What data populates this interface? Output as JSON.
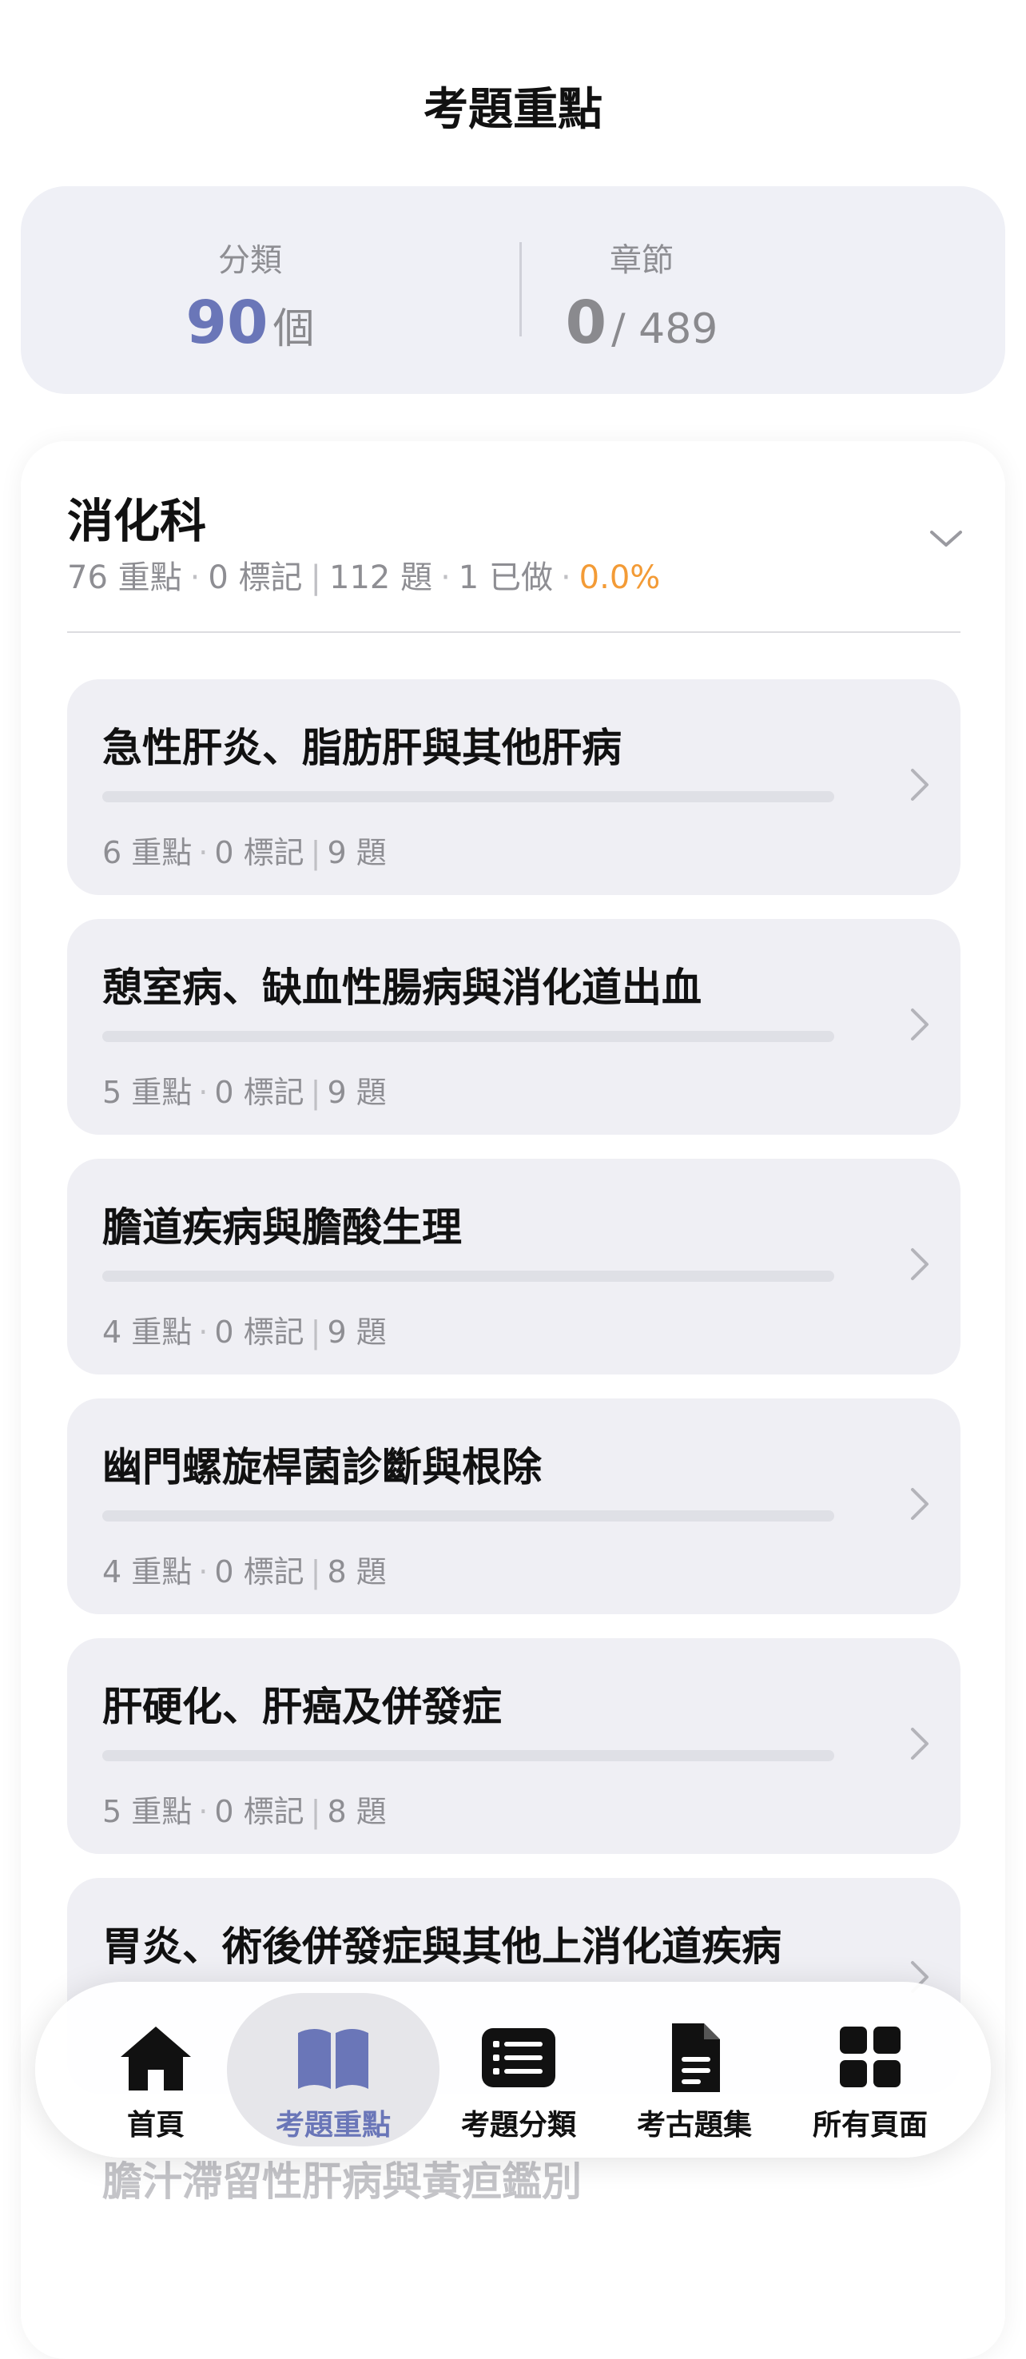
{
  "header": {
    "title": "考題重點"
  },
  "stats": {
    "category_label": "分類",
    "category_value": "90",
    "category_unit": "個",
    "chapter_label": "章節",
    "chapter_done": "0",
    "chapter_total": "/ 489"
  },
  "section": {
    "title": "消化科",
    "points": "76 重點",
    "marks": "0 標記",
    "questions": "112 題",
    "done": "1 已做",
    "percent": "0.0%"
  },
  "chapters": [
    {
      "title": "急性肝炎、脂肪肝與其他肝病",
      "points": "6 重點",
      "marks": "0 標記",
      "questions": "9 題",
      "progress": 0
    },
    {
      "title": "憩室病、缺血性腸病與消化道出血",
      "points": "5 重點",
      "marks": "0 標記",
      "questions": "9 題",
      "progress": 0
    },
    {
      "title": "膽道疾病與膽酸生理",
      "points": "4 重點",
      "marks": "0 標記",
      "questions": "9 題",
      "progress": 0
    },
    {
      "title": "幽門螺旋桿菌診斷與根除",
      "points": "4 重點",
      "marks": "0 標記",
      "questions": "8 題",
      "progress": 0
    },
    {
      "title": "肝硬化、肝癌及併發症",
      "points": "5 重點",
      "marks": "0 標記",
      "questions": "8 題",
      "progress": 0
    },
    {
      "title": "胃炎、術後併發症與其他上消化道疾病"
    }
  ],
  "peek": {
    "title": "膽汁滯留性肝病與黃疸鑑別"
  },
  "tabbar": {
    "accent": "#6a76b8",
    "tabs": [
      {
        "label": "首頁",
        "icon": "home-icon"
      },
      {
        "label": "考題重點",
        "icon": "book-icon",
        "active": true
      },
      {
        "label": "考題分類",
        "icon": "list-icon"
      },
      {
        "label": "考古題集",
        "icon": "document-icon"
      },
      {
        "label": "所有頁面",
        "icon": "grid-icon"
      }
    ]
  }
}
